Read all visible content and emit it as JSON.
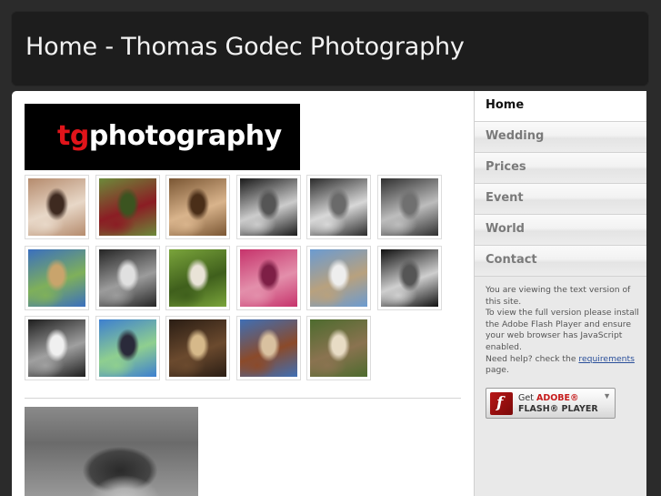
{
  "page": {
    "title": "Home - Thomas Godec Photography"
  },
  "logo": {
    "prefix": "tg",
    "rest": "photography"
  },
  "gallery": {
    "items": [
      {
        "label": "portrait woman close-up",
        "colors": [
          "#b58b6d",
          "#e8d8c8",
          "#3e2a20"
        ]
      },
      {
        "label": "bridal party red dresses",
        "colors": [
          "#6c8a3a",
          "#8b1d24",
          "#3b5420"
        ]
      },
      {
        "label": "bride sepia profile",
        "colors": [
          "#7a5633",
          "#d9b48c",
          "#4a2e18"
        ]
      },
      {
        "label": "bride mirrored black and white",
        "colors": [
          "#1a1a1a",
          "#cccccc",
          "#555555"
        ]
      },
      {
        "label": "couple archway black and white",
        "colors": [
          "#2b2b2b",
          "#d8d8d8",
          "#6a6a6a"
        ]
      },
      {
        "label": "wedding group black and white",
        "colors": [
          "#303030",
          "#bdbdbd",
          "#707070"
        ]
      },
      {
        "label": "couple under tree blue sky",
        "colors": [
          "#3a6fbf",
          "#7fb05a",
          "#c9a46c"
        ]
      },
      {
        "label": "couple street black and white",
        "colors": [
          "#252525",
          "#9c9c9c",
          "#e0e0e0"
        ]
      },
      {
        "label": "couple on green lawn",
        "colors": [
          "#7aa43b",
          "#3f5f1c",
          "#e9e3d7"
        ]
      },
      {
        "label": "bridesmaids pink dresses",
        "colors": [
          "#c6336b",
          "#e38fab",
          "#7e1f46"
        ]
      },
      {
        "label": "bride at seaside wall",
        "colors": [
          "#6b9bd1",
          "#b8a17e",
          "#eeeeee"
        ]
      },
      {
        "label": "bride doorway black and white",
        "colors": [
          "#111111",
          "#cfcfcf",
          "#555555"
        ]
      },
      {
        "label": "bride by lake black and white",
        "colors": [
          "#1e1e1e",
          "#a0a0a0",
          "#f0f0f0"
        ]
      },
      {
        "label": "groom jumping blue sky",
        "colors": [
          "#3d7fd0",
          "#8fcf8f",
          "#2a2a3a"
        ]
      },
      {
        "label": "couple in cathedral aisle",
        "colors": [
          "#2a1d14",
          "#6b4a2e",
          "#d6b98a"
        ]
      },
      {
        "label": "couple on bridge",
        "colors": [
          "#3f6fb5",
          "#8b4a2a",
          "#d9c1a0"
        ]
      },
      {
        "label": "bride on stone steps",
        "colors": [
          "#4d6b2e",
          "#8a7350",
          "#e8dcc5"
        ]
      }
    ]
  },
  "nav": {
    "items": [
      {
        "label": "Home",
        "active": true
      },
      {
        "label": "Wedding",
        "active": false
      },
      {
        "label": "Prices",
        "active": false
      },
      {
        "label": "Event",
        "active": false
      },
      {
        "label": "World",
        "active": false
      },
      {
        "label": "Contact",
        "active": false
      }
    ]
  },
  "notice": {
    "line1": "You are viewing the text version of this site.",
    "line2": "To view the full version please install the Adobe Flash Player and ensure your web browser has JavaScript enabled.",
    "line3_pre": "Need help? check the",
    "link": "requirements",
    "line3_post": "page."
  },
  "flash_button": {
    "get": "Get",
    "brand": "ADOBE",
    "reg": "®",
    "product": "FLASH® PLAYER",
    "icon": "flash-icon",
    "arrow": "download-arrow-icon"
  },
  "colors": {
    "header_bg": "#1d1d1d",
    "accent_red": "#e0141a",
    "sidebar_bg": "#e9e9e9"
  }
}
